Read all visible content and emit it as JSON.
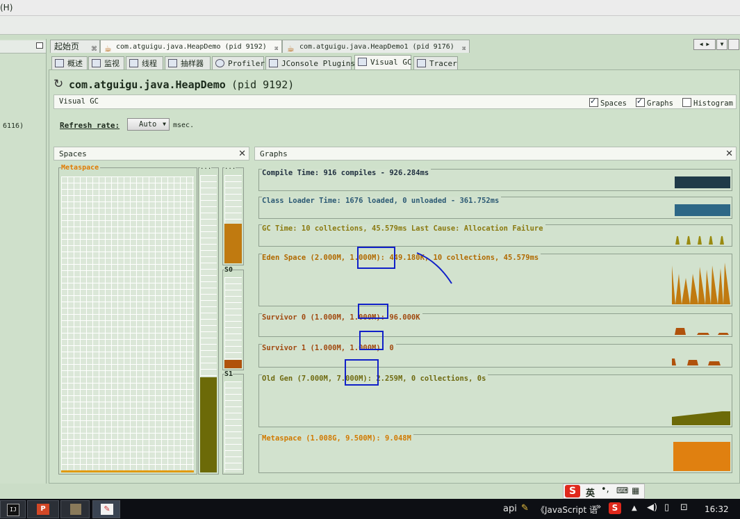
{
  "menu": {
    "help": "(H)"
  },
  "left_pane": {
    "frag": "6116)"
  },
  "doc_tabs": [
    {
      "label": "起始页"
    },
    {
      "label": "com.atguigu.java.HeapDemo (pid 9192)"
    },
    {
      "label": "com.atguigu.java.HeapDemo1 (pid 9176)"
    }
  ],
  "sub_tabs": [
    {
      "label": "概述"
    },
    {
      "label": "监视"
    },
    {
      "label": "线程"
    },
    {
      "label": "抽样器"
    },
    {
      "label": "Profiler"
    },
    {
      "label": "JConsole Plugins"
    },
    {
      "label": "Visual GC"
    },
    {
      "label": "Tracer"
    }
  ],
  "app": {
    "title": "com.atguigu.java.HeapDemo",
    "pid": "(pid 9192)",
    "section": "Visual GC",
    "spaces_label": "Spaces",
    "graphs_label": "Graphs",
    "histogram_label": "Histogram",
    "spaces_checked": true,
    "graphs_checked": true,
    "histogram_checked": false,
    "refresh_label": "Refresh rate:",
    "refresh_value": "Auto",
    "refresh_unit": "msec."
  },
  "spaces_panel": {
    "title": "Spaces",
    "metaspace": "Metaspace",
    "old_label": "...",
    "eden_label": "...",
    "s0": "S0",
    "s1": "S1",
    "levels": {
      "eden": 0.45,
      "s0": 0.09,
      "old": 0.32,
      "metaspace": 0.01
    }
  },
  "graphs_panel": {
    "title": "Graphs",
    "rows": [
      {
        "text": "Compile Time: 916 compiles - 926.284ms",
        "color": "#203040"
      },
      {
        "text": "Class Loader Time: 1676 loaded, 0 unloaded - 361.752ms",
        "color": "#2c5a74"
      },
      {
        "text": "GC Time: 10 collections, 45.579ms Last Cause: Allocation Failure",
        "color": "#8a7a10"
      },
      {
        "text": "Eden Space (2.000M, 1.000M): 449.180K, 10 collections, 45.579ms",
        "color": "#b06a00"
      },
      {
        "text": "Survivor 0 (1.000M, 1.000M): 96.000K",
        "color": "#a04a10"
      },
      {
        "text": "Survivor 1 (1.000M, 1.000M): 0",
        "color": "#a04a10"
      },
      {
        "text": "Old Gen (7.000M, 7.000M): 2.259M, 0 collections, 0s",
        "color": "#6e6a10"
      },
      {
        "text": "Metaspace (1.008G, 9.500M): 9.048M",
        "color": "#d07a00"
      }
    ]
  },
  "ime": {
    "label": "英"
  },
  "taskbar": {
    "api": "api",
    "js_doc": "《JavaScript 语",
    "time": "16:32"
  },
  "colors": {
    "accent_blue": "#1020c8",
    "eden": "#c07a10",
    "old": "#6c6a08",
    "metaspace": "#e08010"
  }
}
